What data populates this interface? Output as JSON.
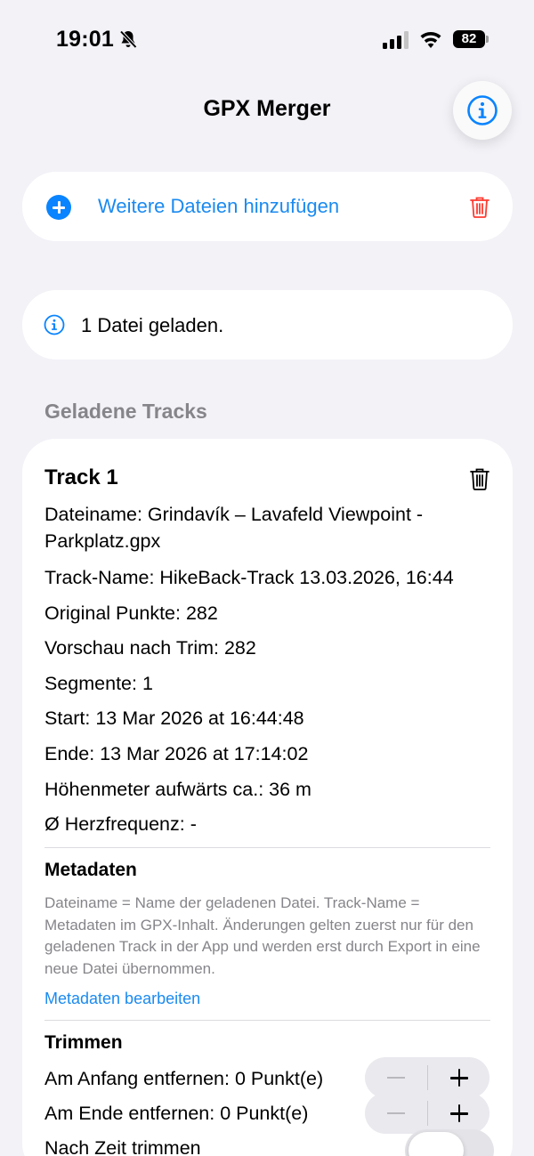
{
  "status_bar": {
    "time": "19:01",
    "battery": "82"
  },
  "nav": {
    "title": "GPX Merger"
  },
  "add_files": {
    "label": "Weitere Dateien hinzufügen"
  },
  "info": {
    "text": "1 Datei geladen."
  },
  "section": {
    "title": "Geladene Tracks"
  },
  "track": {
    "title": "Track 1",
    "filename_line1": "Dateiname: Grindavík – Lavafeld Viewpoint -",
    "filename_line2": "Parkplatz.gpx",
    "track_name": "Track-Name: HikeBack-Track 13.03.2026, 16:44",
    "original_points": "Original Punkte: 282",
    "preview_after_trim": "Vorschau nach Trim: 282",
    "segments": "Segmente: 1",
    "start": "Start: 13 Mar 2026 at 16:44:48",
    "end": "Ende: 13 Mar 2026 at 17:14:02",
    "elevation": "Höhenmeter aufwärts ca.: 36 m",
    "heart_rate": "Ø Herzfrequenz: -",
    "metadata": {
      "title": "Metadaten",
      "description": "Dateiname = Name der geladenen Datei. Track-Name = Metadaten im GPX-Inhalt. Änderungen gelten zuerst nur für den geladenen Track in der App und werden erst durch Export in eine neue Datei übernommen.",
      "edit_link": "Metadaten bearbeiten"
    },
    "trim": {
      "title": "Trimmen",
      "start_remove": "Am Anfang entfernen: 0 Punkt(e)",
      "end_remove": "Am Ende entfernen: 0 Punkt(e)",
      "by_time": "Nach Zeit trimmen",
      "by_time_enabled": false
    }
  },
  "colors": {
    "accent": "#0a84ff",
    "destructive": "#ff3b30",
    "background": "#f2f2f7",
    "secondary_text": "#85858a"
  }
}
